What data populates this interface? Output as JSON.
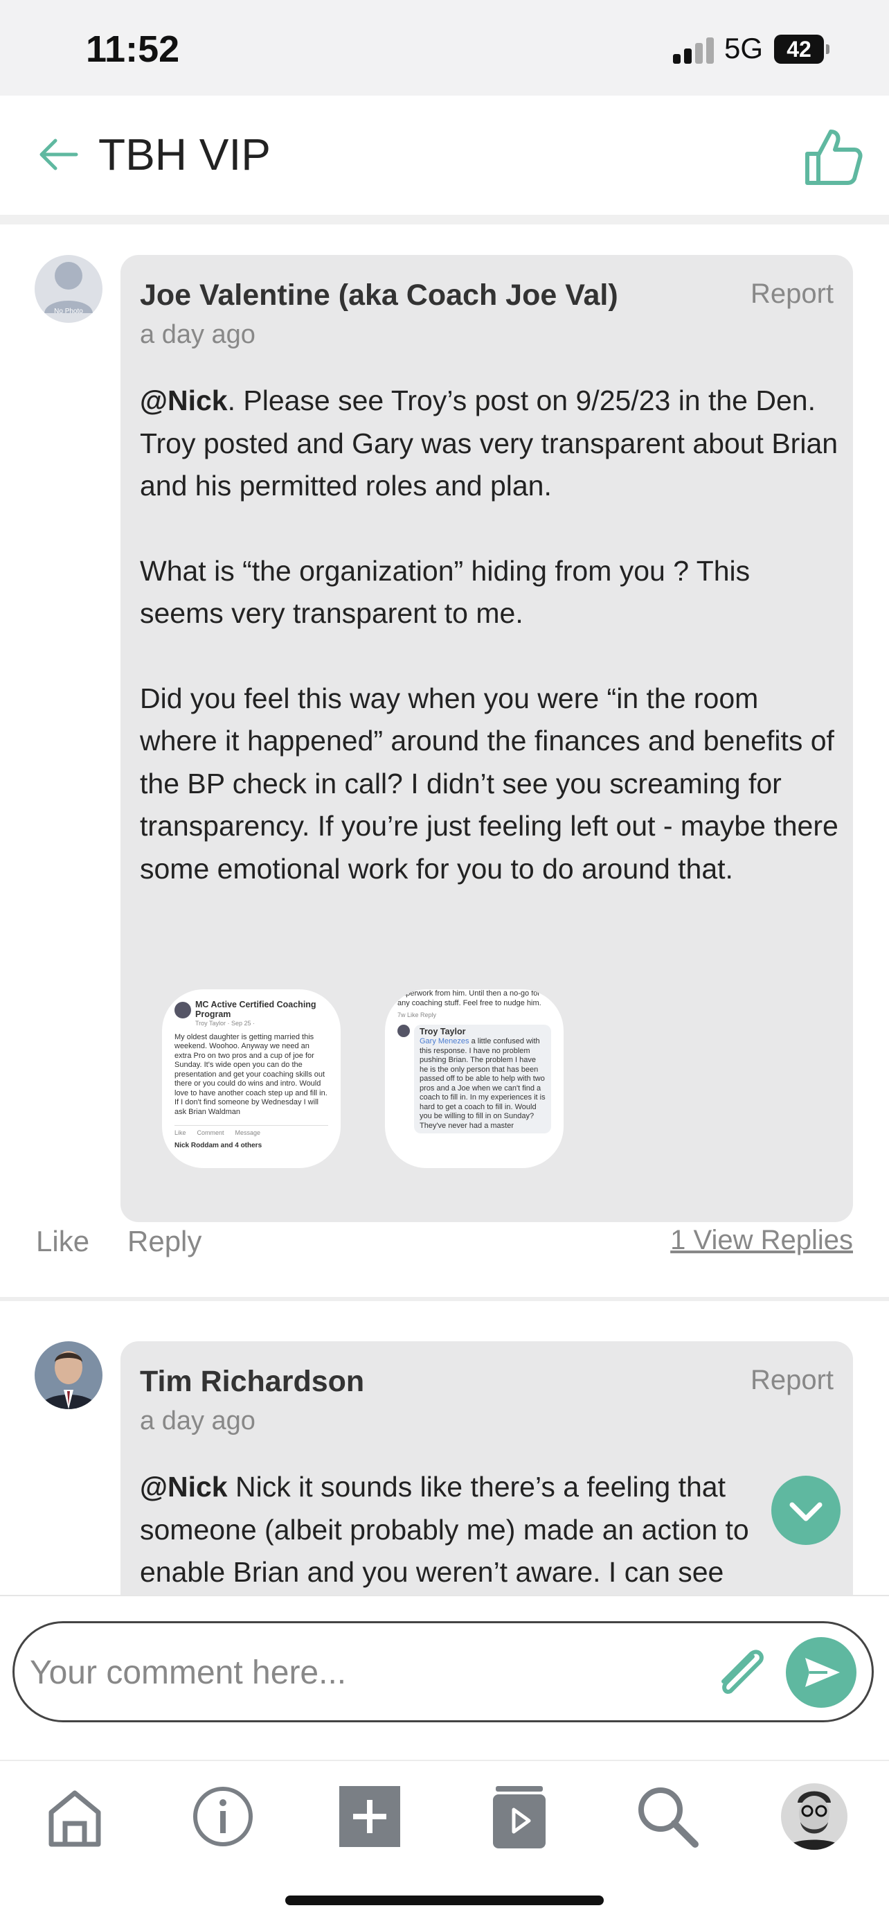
{
  "status_bar": {
    "time": "11:52",
    "network": "5G",
    "battery": "42"
  },
  "header": {
    "title": "TBH VIP"
  },
  "comments": [
    {
      "author": "Joe Valentine (aka Coach Joe Val)",
      "time": "a day ago",
      "report_label": "Report",
      "mention": "@Nick",
      "paragraphs": [
        ".   Please see Troy’s post on 9/25/23 in the Den. Troy posted and Gary was very transparent about Brian and his permitted roles and plan.",
        "What is “the organization” hiding from you ?  This seems very transparent to me.",
        "Did you feel this way when you were “in the room where it happened” around the finances and benefits of the BP check in call?   I didn’t see you screaming for transparency.   If you’re just feeling left out - maybe there some emotional work for you to do around that."
      ],
      "attachments": [
        {
          "group": "MC Active Certified Coaching Program",
          "poster": "Troy Taylor · Sep 25 · ",
          "text": "My oldest daughter is getting married this weekend. Woohoo. Anyway we need an extra Pro on two pros and a cup of joe for Sunday. It's wide open you can do the presentation and get your coaching skills out there or you could do wins and intro. Would love to have another coach step up and fill in. If I don't find someone by Wednesday I will ask Brian Waldman",
          "like": "Like",
          "comment": "Comment",
          "message": "Message",
          "reactions": "Nick Roddam and 4 others"
        },
        {
          "top": "paperwork from him.  Until then a no-go for any coaching stuff.  Feel free to nudge him.",
          "meta": "7w   Like   Reply",
          "name": "Troy Taylor",
          "mention": "Gary Menezes",
          "text": " a little confused with this response. I have no problem pushing Brian. The problem I have he is the only person that has been passed off to be able to help with two pros and a Joe when we can't find a coach to fill in. In my experiences it is hard to get a coach to fill in. Would you be willing to fill in on Sunday? They've never had a master"
        }
      ],
      "like_label": "Like",
      "reply_label": "Reply",
      "view_replies_label": "1 View Replies"
    },
    {
      "author": "Tim Richardson",
      "time": "a day ago",
      "report_label": "Report",
      "mention": "@Nick",
      "text": " Nick it sounds like there’s a feeling that someone (albeit probably me) made an action to enable Brian and you weren’t aware. I can see"
    }
  ],
  "composer": {
    "placeholder": "Your comment here..."
  },
  "avatar_placeholder": "No Photo",
  "colors": {
    "accent": "#5fb8a0",
    "bubble": "#e8e8e9",
    "muted": "#888888"
  },
  "icons": [
    "back-arrow-icon",
    "thumbs-up-icon",
    "chevron-down-icon",
    "paperclip-icon",
    "send-icon",
    "home-icon",
    "info-icon",
    "add-icon",
    "video-library-icon",
    "search-icon"
  ]
}
